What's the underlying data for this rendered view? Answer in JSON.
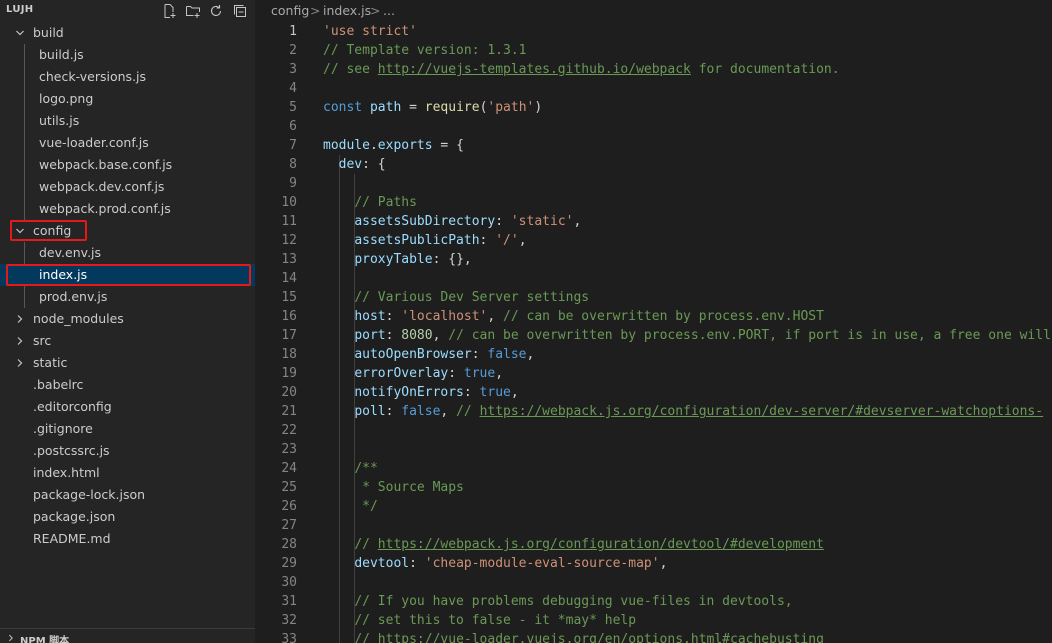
{
  "explorer": {
    "title": "LUJH",
    "actions": [
      "new-file-icon",
      "new-folder-icon",
      "refresh-icon",
      "collapse-all-icon"
    ],
    "items": [
      {
        "label": "build",
        "type": "folder",
        "expanded": true,
        "depth": 0
      },
      {
        "label": "build.js",
        "type": "file",
        "depth": 1
      },
      {
        "label": "check-versions.js",
        "type": "file",
        "depth": 1
      },
      {
        "label": "logo.png",
        "type": "file",
        "depth": 1
      },
      {
        "label": "utils.js",
        "type": "file",
        "depth": 1
      },
      {
        "label": "vue-loader.conf.js",
        "type": "file",
        "depth": 1
      },
      {
        "label": "webpack.base.conf.js",
        "type": "file",
        "depth": 1
      },
      {
        "label": "webpack.dev.conf.js",
        "type": "file",
        "depth": 1
      },
      {
        "label": "webpack.prod.conf.js",
        "type": "file",
        "depth": 1
      },
      {
        "label": "config",
        "type": "folder",
        "expanded": true,
        "depth": 0
      },
      {
        "label": "dev.env.js",
        "type": "file",
        "depth": 1
      },
      {
        "label": "index.js",
        "type": "file",
        "depth": 1,
        "selected": true
      },
      {
        "label": "prod.env.js",
        "type": "file",
        "depth": 1
      },
      {
        "label": "node_modules",
        "type": "folder",
        "expanded": false,
        "depth": 0
      },
      {
        "label": "src",
        "type": "folder",
        "expanded": false,
        "depth": 0
      },
      {
        "label": "static",
        "type": "folder",
        "expanded": false,
        "depth": 0
      },
      {
        "label": ".babelrc",
        "type": "file",
        "depth": 0
      },
      {
        "label": ".editorconfig",
        "type": "file",
        "depth": 0
      },
      {
        "label": ".gitignore",
        "type": "file",
        "depth": 0
      },
      {
        "label": ".postcssrc.js",
        "type": "file",
        "depth": 0
      },
      {
        "label": "index.html",
        "type": "file",
        "depth": 0
      },
      {
        "label": "package-lock.json",
        "type": "file",
        "depth": 0
      },
      {
        "label": "package.json",
        "type": "file",
        "depth": 0
      },
      {
        "label": "README.md",
        "type": "file",
        "depth": 0
      }
    ],
    "bottom_section": "NPM 脚本"
  },
  "breadcrumb": {
    "segments": [
      "config",
      "index.js",
      "..."
    ],
    "separator": ">"
  },
  "editor": {
    "active_line": 1,
    "lines": [
      {
        "n": "1",
        "tokens": [
          [
            "str",
            "'use strict'"
          ]
        ]
      },
      {
        "n": "2",
        "tokens": [
          [
            "cmt",
            "// Template version: 1.3.1"
          ]
        ]
      },
      {
        "n": "3",
        "tokens": [
          [
            "cmt",
            "// see "
          ],
          [
            "lnk",
            "http://vuejs-templates.github.io/webpack"
          ],
          [
            "cmt",
            " for documentation."
          ]
        ]
      },
      {
        "n": "4",
        "tokens": []
      },
      {
        "n": "5",
        "tokens": [
          [
            "kw",
            "const"
          ],
          [
            "pun",
            " "
          ],
          [
            "var",
            "path"
          ],
          [
            "pun",
            " = "
          ],
          [
            "fn",
            "require"
          ],
          [
            "pun",
            "("
          ],
          [
            "str",
            "'path'"
          ],
          [
            "pun",
            ")"
          ]
        ]
      },
      {
        "n": "6",
        "tokens": []
      },
      {
        "n": "7",
        "tokens": [
          [
            "var",
            "module"
          ],
          [
            "pun",
            "."
          ],
          [
            "var",
            "exports"
          ],
          [
            "pun",
            " = {"
          ]
        ]
      },
      {
        "n": "8",
        "tokens": [
          [
            "pun",
            "  "
          ],
          [
            "var",
            "dev"
          ],
          [
            "pun",
            ": {"
          ]
        ]
      },
      {
        "n": "9",
        "tokens": []
      },
      {
        "n": "10",
        "tokens": [
          [
            "pun",
            "    "
          ],
          [
            "cmt",
            "// Paths"
          ]
        ]
      },
      {
        "n": "11",
        "tokens": [
          [
            "pun",
            "    "
          ],
          [
            "var",
            "assetsSubDirectory"
          ],
          [
            "pun",
            ": "
          ],
          [
            "str",
            "'static'"
          ],
          [
            "pun",
            ","
          ]
        ]
      },
      {
        "n": "12",
        "tokens": [
          [
            "pun",
            "    "
          ],
          [
            "var",
            "assetsPublicPath"
          ],
          [
            "pun",
            ": "
          ],
          [
            "str",
            "'/'"
          ],
          [
            "pun",
            ","
          ]
        ]
      },
      {
        "n": "13",
        "tokens": [
          [
            "pun",
            "    "
          ],
          [
            "var",
            "proxyTable"
          ],
          [
            "pun",
            ": {},"
          ]
        ]
      },
      {
        "n": "14",
        "tokens": []
      },
      {
        "n": "15",
        "tokens": [
          [
            "pun",
            "    "
          ],
          [
            "cmt",
            "// Various Dev Server settings"
          ]
        ]
      },
      {
        "n": "16",
        "tokens": [
          [
            "pun",
            "    "
          ],
          [
            "var",
            "host"
          ],
          [
            "pun",
            ": "
          ],
          [
            "str",
            "'localhost'"
          ],
          [
            "pun",
            ", "
          ],
          [
            "cmt",
            "// can be overwritten by process.env.HOST"
          ]
        ]
      },
      {
        "n": "17",
        "tokens": [
          [
            "pun",
            "    "
          ],
          [
            "var",
            "port"
          ],
          [
            "pun",
            ": "
          ],
          [
            "num",
            "8080"
          ],
          [
            "pun",
            ", "
          ],
          [
            "cmt",
            "// can be overwritten by process.env.PORT, if port is in use, a free one will be determined"
          ]
        ]
      },
      {
        "n": "18",
        "tokens": [
          [
            "pun",
            "    "
          ],
          [
            "var",
            "autoOpenBrowser"
          ],
          [
            "pun",
            ": "
          ],
          [
            "kw",
            "false"
          ],
          [
            "pun",
            ","
          ]
        ]
      },
      {
        "n": "19",
        "tokens": [
          [
            "pun",
            "    "
          ],
          [
            "var",
            "errorOverlay"
          ],
          [
            "pun",
            ": "
          ],
          [
            "kw",
            "true"
          ],
          [
            "pun",
            ","
          ]
        ]
      },
      {
        "n": "20",
        "tokens": [
          [
            "pun",
            "    "
          ],
          [
            "var",
            "notifyOnErrors"
          ],
          [
            "pun",
            ": "
          ],
          [
            "kw",
            "true"
          ],
          [
            "pun",
            ","
          ]
        ]
      },
      {
        "n": "21",
        "tokens": [
          [
            "pun",
            "    "
          ],
          [
            "var",
            "poll"
          ],
          [
            "pun",
            ": "
          ],
          [
            "kw",
            "false"
          ],
          [
            "pun",
            ", "
          ],
          [
            "cmt",
            "// "
          ],
          [
            "lnk",
            "https://webpack.js.org/configuration/dev-server/#devserver-watchoptions-"
          ]
        ]
      },
      {
        "n": "22",
        "tokens": []
      },
      {
        "n": "23",
        "tokens": []
      },
      {
        "n": "24",
        "tokens": [
          [
            "pun",
            "    "
          ],
          [
            "cmt",
            "/**"
          ]
        ]
      },
      {
        "n": "25",
        "tokens": [
          [
            "pun",
            "    "
          ],
          [
            "cmt",
            " * Source Maps"
          ]
        ]
      },
      {
        "n": "26",
        "tokens": [
          [
            "pun",
            "    "
          ],
          [
            "cmt",
            " */"
          ]
        ]
      },
      {
        "n": "27",
        "tokens": []
      },
      {
        "n": "28",
        "tokens": [
          [
            "pun",
            "    "
          ],
          [
            "cmt",
            "// "
          ],
          [
            "lnk",
            "https://webpack.js.org/configuration/devtool/#development"
          ]
        ]
      },
      {
        "n": "29",
        "tokens": [
          [
            "pun",
            "    "
          ],
          [
            "var",
            "devtool"
          ],
          [
            "pun",
            ": "
          ],
          [
            "str",
            "'cheap-module-eval-source-map'"
          ],
          [
            "pun",
            ","
          ]
        ]
      },
      {
        "n": "30",
        "tokens": []
      },
      {
        "n": "31",
        "tokens": [
          [
            "pun",
            "    "
          ],
          [
            "cmt",
            "// If you have problems debugging vue-files in devtools,"
          ]
        ]
      },
      {
        "n": "32",
        "tokens": [
          [
            "pun",
            "    "
          ],
          [
            "cmt",
            "// set this to false - it *may* help"
          ]
        ]
      },
      {
        "n": "33",
        "tokens": [
          [
            "pun",
            "    "
          ],
          [
            "cmt",
            "// "
          ],
          [
            "lnk",
            "https://vue-loader.vuejs.org/en/options.html#cachebusting"
          ]
        ]
      }
    ]
  },
  "colors": {
    "selection": "#04395e",
    "annotation": "#e51919",
    "string": "#ce9178",
    "comment": "#6a9955",
    "keyword": "#569cd6",
    "variable": "#9cdcfe",
    "function": "#dcdcaa",
    "number": "#b5cea8"
  }
}
